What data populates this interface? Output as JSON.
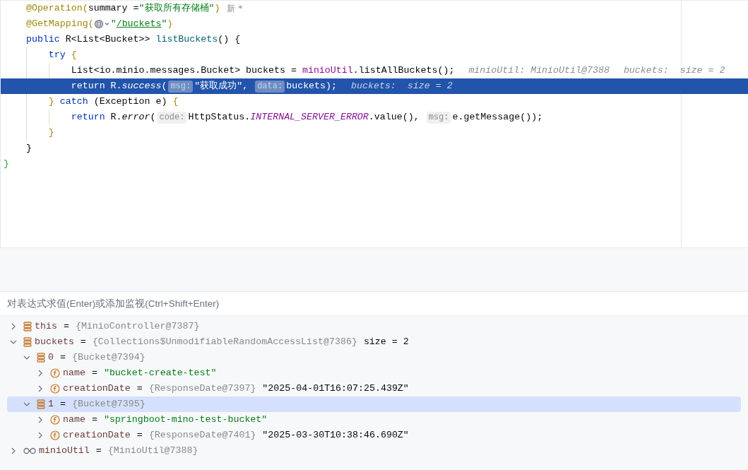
{
  "editor": {
    "lines": [
      {
        "selected": false,
        "tokens": [
          {
            "kind": "annotation",
            "text": "    @Operation("
          },
          {
            "kind": "plain",
            "text": "summary ="
          },
          {
            "kind": "string",
            "text": "\"获取所有存储桶\""
          },
          {
            "kind": "annotation",
            "text": ")"
          },
          {
            "kind": "note",
            "text": "新 *"
          }
        ]
      },
      {
        "selected": false,
        "tokens": [
          {
            "kind": "annotation",
            "text": "    @GetMapping("
          },
          {
            "kind": "globe"
          },
          {
            "kind": "string",
            "text": "\""
          },
          {
            "kind": "url",
            "text": "/buckets"
          },
          {
            "kind": "string",
            "text": "\""
          },
          {
            "kind": "annotation",
            "text": ")"
          }
        ]
      },
      {
        "selected": false,
        "tokens": [
          {
            "kind": "keyword",
            "text": "    public "
          },
          {
            "kind": "plain",
            "text": "R<List<Bucket>> "
          },
          {
            "kind": "decl",
            "text": "listBuckets"
          },
          {
            "kind": "plain",
            "text": "() {"
          }
        ]
      },
      {
        "selected": false,
        "tokens": [
          {
            "kind": "keyword",
            "text": "        try "
          },
          {
            "kind": "brace",
            "text": "{"
          }
        ]
      },
      {
        "selected": false,
        "tokens": [
          {
            "kind": "plain",
            "text": "            List<io.minio.messages.Bucket> buckets = "
          },
          {
            "kind": "field",
            "text": "minioUtil"
          },
          {
            "kind": "plain",
            "text": ".listAllBuckets();"
          },
          {
            "kind": "debug",
            "text": "minioUtil: MinioUtil@7388"
          },
          {
            "kind": "debug",
            "text": "buckets:  size = 2"
          }
        ]
      },
      {
        "selected": true,
        "tokens": [
          {
            "kind": "keyword",
            "text": "            return "
          },
          {
            "kind": "plain",
            "text": "R."
          },
          {
            "kind": "static",
            "text": "success"
          },
          {
            "kind": "plain",
            "text": "("
          },
          {
            "kind": "hint",
            "text": "msg:"
          },
          {
            "kind": "string",
            "text": "\"获取成功\""
          },
          {
            "kind": "plain",
            "text": ", "
          },
          {
            "kind": "hint",
            "text": "data:"
          },
          {
            "kind": "plain",
            "text": "buckets);"
          },
          {
            "kind": "debug",
            "text": "buckets:  size = 2"
          }
        ]
      },
      {
        "selected": false,
        "tokens": [
          {
            "kind": "brace",
            "text": "        } "
          },
          {
            "kind": "keyword",
            "text": "catch "
          },
          {
            "kind": "plain",
            "text": "(Exception e) "
          },
          {
            "kind": "brace",
            "text": "{"
          }
        ]
      },
      {
        "selected": false,
        "tokens": [
          {
            "kind": "keyword",
            "text": "            return "
          },
          {
            "kind": "plain",
            "text": "R."
          },
          {
            "kind": "static",
            "text": "error"
          },
          {
            "kind": "plain",
            "text": "("
          },
          {
            "kind": "hint",
            "text": "code:"
          },
          {
            "kind": "plain",
            "text": "HttpStatus."
          },
          {
            "kind": "constant",
            "text": "INTERNAL_SERVER_ERROR"
          },
          {
            "kind": "plain",
            "text": ".value(), "
          },
          {
            "kind": "hint",
            "text": "msg:"
          },
          {
            "kind": "plain",
            "text": "e.getMessage());"
          }
        ]
      },
      {
        "selected": false,
        "tokens": [
          {
            "kind": "brace",
            "text": "        }"
          }
        ]
      },
      {
        "selected": false,
        "tokens": [
          {
            "kind": "plain",
            "text": "    }"
          }
        ]
      },
      {
        "selected": false,
        "tokens": [
          {
            "kind": "outer",
            "text": "}"
          }
        ]
      }
    ]
  },
  "evaluate_field": {
    "placeholder": "对表达式求值(Enter)或添加监视(Ctrl+Shift+Enter)"
  },
  "variables": [
    {
      "kind": "object",
      "name": "this",
      "op": "=",
      "type": "{MinioController@7387}",
      "expanded": false,
      "selected": false
    },
    {
      "kind": "object",
      "name": "buckets",
      "op": "=",
      "type": "{Collections$UnmodifiableRandomAccessList@7386}",
      "value": {
        "kind": "plain",
        "text": "size = 2"
      },
      "expanded": true,
      "selected": false,
      "children": [
        {
          "kind": "object",
          "name": "0",
          "op": "=",
          "type": "{Bucket@7394}",
          "expanded": true,
          "selected": false,
          "children": [
            {
              "kind": "field",
              "name": "name",
              "op": "=",
              "value": {
                "kind": "string",
                "text": "\"bucket-create-test\""
              },
              "expanded": false,
              "selected": false
            },
            {
              "kind": "field",
              "name": "creationDate",
              "op": "=",
              "type": "{ResponseDate@7397}",
              "value": {
                "kind": "plain",
                "text": "\"2025-04-01T16:07:25.439Z\""
              },
              "expanded": false,
              "selected": false
            }
          ]
        },
        {
          "kind": "object",
          "name": "1",
          "op": "=",
          "type": "{Bucket@7395}",
          "expanded": true,
          "selected": true,
          "children": [
            {
              "kind": "field",
              "name": "name",
              "op": "=",
              "value": {
                "kind": "string",
                "text": "\"springboot-mino-test-bucket\""
              },
              "expanded": false,
              "selected": false
            },
            {
              "kind": "field",
              "name": "creationDate",
              "op": "=",
              "type": "{ResponseDate@7401}",
              "value": {
                "kind": "plain",
                "text": "\"2025-03-30T10:38:46.690Z\""
              },
              "expanded": false,
              "selected": false
            }
          ]
        }
      ]
    },
    {
      "kind": "watch",
      "name": "minioUtil",
      "op": "=",
      "type": "{MinioUtil@7388}",
      "expanded": false,
      "selected": false
    }
  ]
}
